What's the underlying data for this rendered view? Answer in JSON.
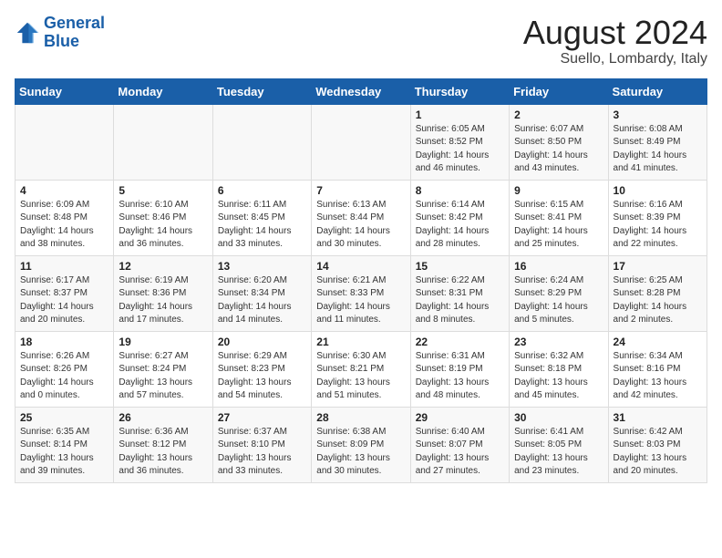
{
  "header": {
    "logo_line1": "General",
    "logo_line2": "Blue",
    "title": "August 2024",
    "subtitle": "Suello, Lombardy, Italy"
  },
  "weekdays": [
    "Sunday",
    "Monday",
    "Tuesday",
    "Wednesday",
    "Thursday",
    "Friday",
    "Saturday"
  ],
  "weeks": [
    [
      {
        "day": "",
        "detail": ""
      },
      {
        "day": "",
        "detail": ""
      },
      {
        "day": "",
        "detail": ""
      },
      {
        "day": "",
        "detail": ""
      },
      {
        "day": "1",
        "detail": "Sunrise: 6:05 AM\nSunset: 8:52 PM\nDaylight: 14 hours\nand 46 minutes."
      },
      {
        "day": "2",
        "detail": "Sunrise: 6:07 AM\nSunset: 8:50 PM\nDaylight: 14 hours\nand 43 minutes."
      },
      {
        "day": "3",
        "detail": "Sunrise: 6:08 AM\nSunset: 8:49 PM\nDaylight: 14 hours\nand 41 minutes."
      }
    ],
    [
      {
        "day": "4",
        "detail": "Sunrise: 6:09 AM\nSunset: 8:48 PM\nDaylight: 14 hours\nand 38 minutes."
      },
      {
        "day": "5",
        "detail": "Sunrise: 6:10 AM\nSunset: 8:46 PM\nDaylight: 14 hours\nand 36 minutes."
      },
      {
        "day": "6",
        "detail": "Sunrise: 6:11 AM\nSunset: 8:45 PM\nDaylight: 14 hours\nand 33 minutes."
      },
      {
        "day": "7",
        "detail": "Sunrise: 6:13 AM\nSunset: 8:44 PM\nDaylight: 14 hours\nand 30 minutes."
      },
      {
        "day": "8",
        "detail": "Sunrise: 6:14 AM\nSunset: 8:42 PM\nDaylight: 14 hours\nand 28 minutes."
      },
      {
        "day": "9",
        "detail": "Sunrise: 6:15 AM\nSunset: 8:41 PM\nDaylight: 14 hours\nand 25 minutes."
      },
      {
        "day": "10",
        "detail": "Sunrise: 6:16 AM\nSunset: 8:39 PM\nDaylight: 14 hours\nand 22 minutes."
      }
    ],
    [
      {
        "day": "11",
        "detail": "Sunrise: 6:17 AM\nSunset: 8:37 PM\nDaylight: 14 hours\nand 20 minutes."
      },
      {
        "day": "12",
        "detail": "Sunrise: 6:19 AM\nSunset: 8:36 PM\nDaylight: 14 hours\nand 17 minutes."
      },
      {
        "day": "13",
        "detail": "Sunrise: 6:20 AM\nSunset: 8:34 PM\nDaylight: 14 hours\nand 14 minutes."
      },
      {
        "day": "14",
        "detail": "Sunrise: 6:21 AM\nSunset: 8:33 PM\nDaylight: 14 hours\nand 11 minutes."
      },
      {
        "day": "15",
        "detail": "Sunrise: 6:22 AM\nSunset: 8:31 PM\nDaylight: 14 hours\nand 8 minutes."
      },
      {
        "day": "16",
        "detail": "Sunrise: 6:24 AM\nSunset: 8:29 PM\nDaylight: 14 hours\nand 5 minutes."
      },
      {
        "day": "17",
        "detail": "Sunrise: 6:25 AM\nSunset: 8:28 PM\nDaylight: 14 hours\nand 2 minutes."
      }
    ],
    [
      {
        "day": "18",
        "detail": "Sunrise: 6:26 AM\nSunset: 8:26 PM\nDaylight: 14 hours\nand 0 minutes."
      },
      {
        "day": "19",
        "detail": "Sunrise: 6:27 AM\nSunset: 8:24 PM\nDaylight: 13 hours\nand 57 minutes."
      },
      {
        "day": "20",
        "detail": "Sunrise: 6:29 AM\nSunset: 8:23 PM\nDaylight: 13 hours\nand 54 minutes."
      },
      {
        "day": "21",
        "detail": "Sunrise: 6:30 AM\nSunset: 8:21 PM\nDaylight: 13 hours\nand 51 minutes."
      },
      {
        "day": "22",
        "detail": "Sunrise: 6:31 AM\nSunset: 8:19 PM\nDaylight: 13 hours\nand 48 minutes."
      },
      {
        "day": "23",
        "detail": "Sunrise: 6:32 AM\nSunset: 8:18 PM\nDaylight: 13 hours\nand 45 minutes."
      },
      {
        "day": "24",
        "detail": "Sunrise: 6:34 AM\nSunset: 8:16 PM\nDaylight: 13 hours\nand 42 minutes."
      }
    ],
    [
      {
        "day": "25",
        "detail": "Sunrise: 6:35 AM\nSunset: 8:14 PM\nDaylight: 13 hours\nand 39 minutes."
      },
      {
        "day": "26",
        "detail": "Sunrise: 6:36 AM\nSunset: 8:12 PM\nDaylight: 13 hours\nand 36 minutes."
      },
      {
        "day": "27",
        "detail": "Sunrise: 6:37 AM\nSunset: 8:10 PM\nDaylight: 13 hours\nand 33 minutes."
      },
      {
        "day": "28",
        "detail": "Sunrise: 6:38 AM\nSunset: 8:09 PM\nDaylight: 13 hours\nand 30 minutes."
      },
      {
        "day": "29",
        "detail": "Sunrise: 6:40 AM\nSunset: 8:07 PM\nDaylight: 13 hours\nand 27 minutes."
      },
      {
        "day": "30",
        "detail": "Sunrise: 6:41 AM\nSunset: 8:05 PM\nDaylight: 13 hours\nand 23 minutes."
      },
      {
        "day": "31",
        "detail": "Sunrise: 6:42 AM\nSunset: 8:03 PM\nDaylight: 13 hours\nand 20 minutes."
      }
    ]
  ]
}
